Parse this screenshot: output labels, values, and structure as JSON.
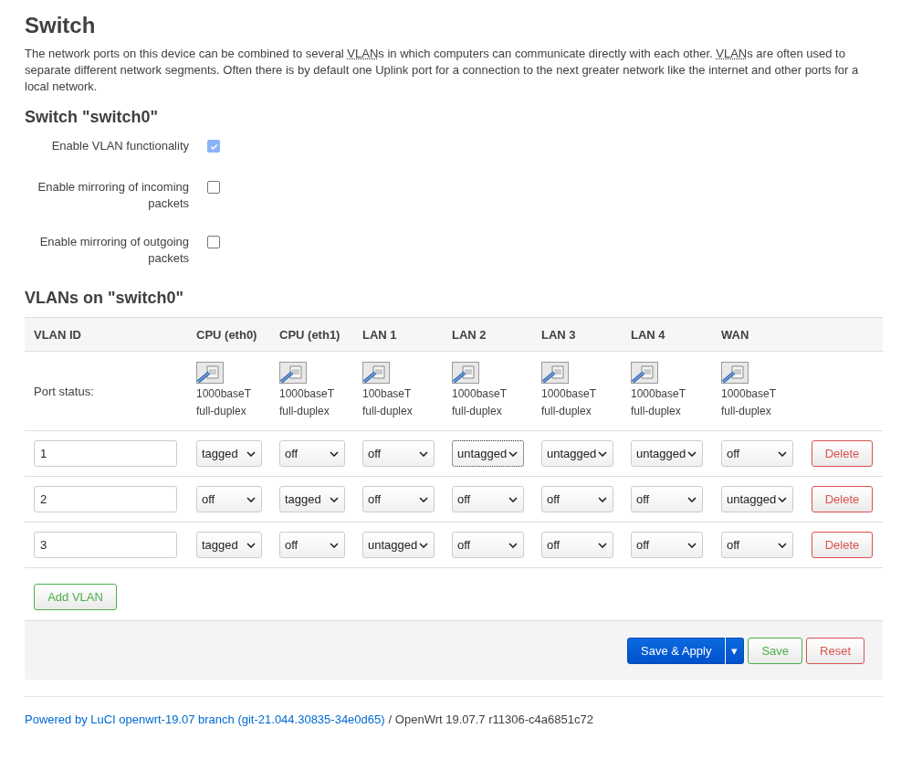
{
  "title": "Switch",
  "description": [
    {
      "kind": "text",
      "text": "The network ports on this device can be combined to several "
    },
    {
      "kind": "abbr",
      "text": "VLAN"
    },
    {
      "kind": "text",
      "text": "s in which computers can communicate directly with each other. "
    },
    {
      "kind": "abbr",
      "text": "VLAN"
    },
    {
      "kind": "text",
      "text": "s are often used to separate different network segments. Often there is by default one Uplink port for a connection to the next greater network like the internet and other ports for a local network."
    }
  ],
  "switch_section": {
    "heading": "Switch \"switch0\"",
    "options": [
      {
        "label": "Enable VLAN functionality",
        "checked": true
      },
      {
        "label": "Enable mirroring of incoming packets",
        "checked": false
      },
      {
        "label": "Enable mirroring of outgoing packets",
        "checked": false
      }
    ]
  },
  "vlan_section": {
    "heading": "VLANs on \"switch0\"",
    "columns": [
      "VLAN ID",
      "CPU (eth0)",
      "CPU (eth1)",
      "LAN 1",
      "LAN 2",
      "LAN 3",
      "LAN 4",
      "WAN"
    ],
    "port_status_label": "Port status:",
    "port_status": [
      {
        "speed": "1000baseT",
        "duplex": "full-duplex"
      },
      {
        "speed": "1000baseT",
        "duplex": "full-duplex"
      },
      {
        "speed": "100baseT",
        "duplex": "full-duplex"
      },
      {
        "speed": "1000baseT",
        "duplex": "full-duplex"
      },
      {
        "speed": "1000baseT",
        "duplex": "full-duplex"
      },
      {
        "speed": "1000baseT",
        "duplex": "full-duplex"
      },
      {
        "speed": "1000baseT",
        "duplex": "full-duplex"
      }
    ],
    "rows": [
      {
        "vlan_id": "1",
        "ports": [
          {
            "value": "tagged",
            "focused": false
          },
          {
            "value": "off",
            "focused": false
          },
          {
            "value": "off",
            "focused": false
          },
          {
            "value": "untagged",
            "focused": true
          },
          {
            "value": "untagged",
            "focused": false
          },
          {
            "value": "untagged",
            "focused": false
          },
          {
            "value": "off",
            "focused": false
          }
        ],
        "delete": "Delete"
      },
      {
        "vlan_id": "2",
        "ports": [
          {
            "value": "off",
            "focused": false
          },
          {
            "value": "tagged",
            "focused": false
          },
          {
            "value": "off",
            "focused": false
          },
          {
            "value": "off",
            "focused": false
          },
          {
            "value": "off",
            "focused": false
          },
          {
            "value": "off",
            "focused": false
          },
          {
            "value": "untagged",
            "focused": false
          }
        ],
        "delete": "Delete"
      },
      {
        "vlan_id": "3",
        "ports": [
          {
            "value": "tagged",
            "focused": false
          },
          {
            "value": "off",
            "focused": false
          },
          {
            "value": "untagged",
            "focused": false
          },
          {
            "value": "off",
            "focused": false
          },
          {
            "value": "off",
            "focused": false
          },
          {
            "value": "off",
            "focused": false
          },
          {
            "value": "off",
            "focused": false
          }
        ],
        "delete": "Delete"
      }
    ],
    "add_button": "Add VLAN"
  },
  "actions": {
    "save_apply": "Save & Apply",
    "dropdown_toggle": "▾",
    "save": "Save",
    "reset": "Reset"
  },
  "footer": {
    "link": "Powered by LuCI openwrt-19.07 branch (git-21.044.30835-34e0d65)",
    "text": "/ OpenWrt 19.07.7 r11306-c4a6851c72"
  }
}
